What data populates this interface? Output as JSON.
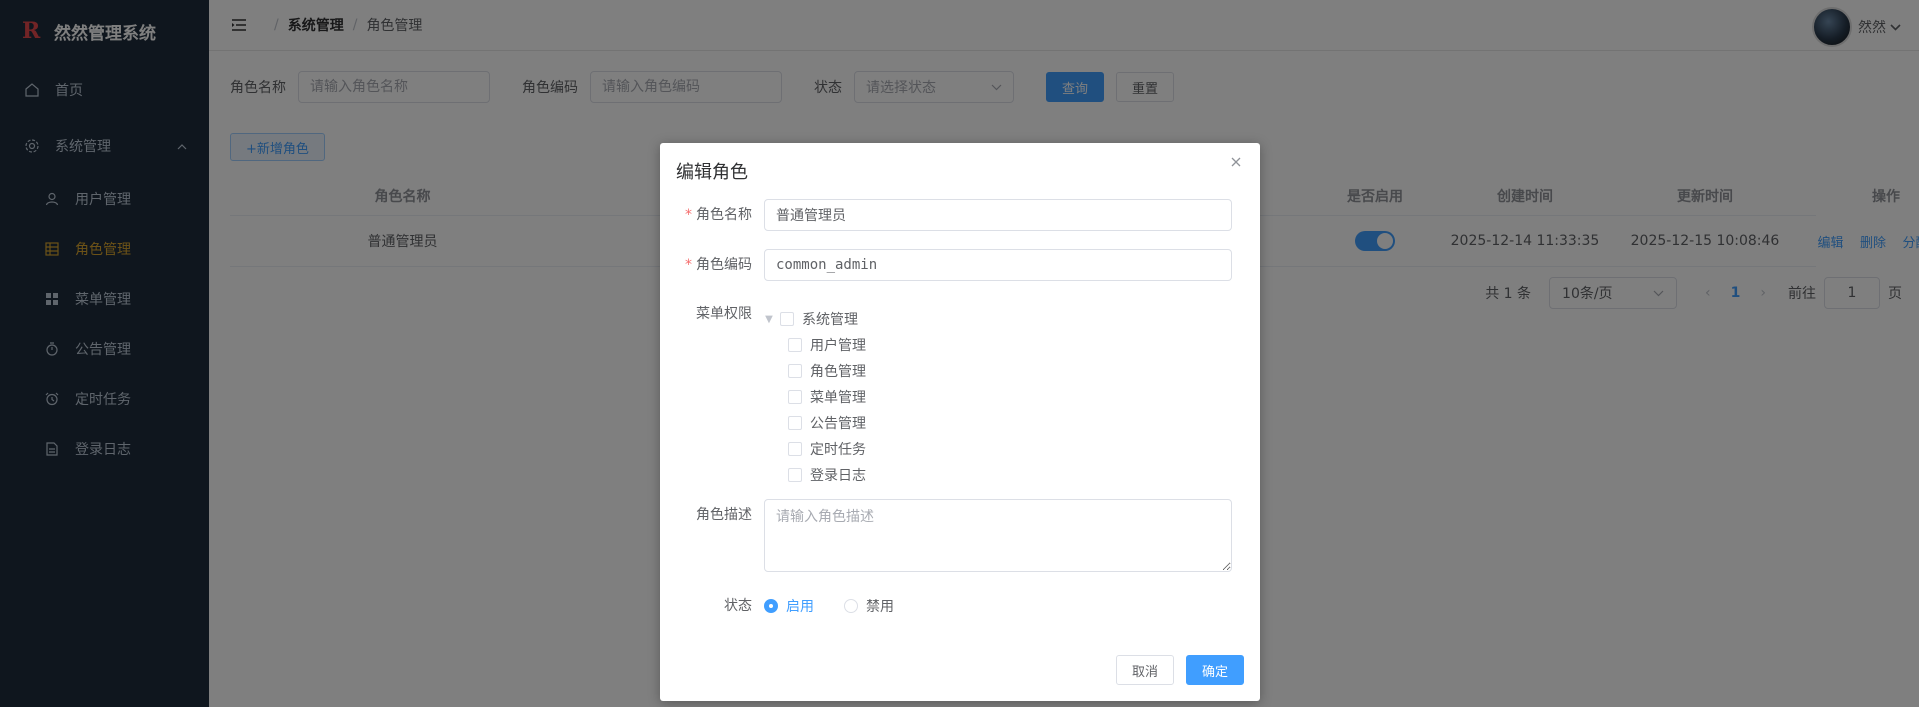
{
  "app": {
    "logo": "R",
    "title": "然然管理系统"
  },
  "sidebar": {
    "home": "首页",
    "system": "系统管理",
    "items": [
      {
        "label": "用户管理",
        "icon": "user-icon"
      },
      {
        "label": "角色管理",
        "icon": "grid-icon",
        "active": true
      },
      {
        "label": "菜单管理",
        "icon": "apps-icon"
      },
      {
        "label": "公告管理",
        "icon": "stopwatch-icon"
      },
      {
        "label": "定时任务",
        "icon": "alarm-clock-icon"
      },
      {
        "label": "登录日志",
        "icon": "document-icon"
      }
    ]
  },
  "header": {
    "breadcrumb": [
      "系统管理",
      "角色管理"
    ],
    "user_name": "然然"
  },
  "search": {
    "role_name_label": "角色名称",
    "role_name_placeholder": "请输入角色名称",
    "role_code_label": "角色编码",
    "role_code_placeholder": "请输入角色编码",
    "status_label": "状态",
    "status_placeholder": "请选择状态",
    "query_button": "查询",
    "reset_button": "重置"
  },
  "toolbar": {
    "add_button": "+新增角色"
  },
  "table": {
    "headers": [
      "角色名称",
      "是否启用",
      "创建时间",
      "更新时间",
      "操作"
    ],
    "rows": [
      {
        "name": "普通管理员",
        "enabled": true,
        "created": "2025-12-14 11:33:35",
        "updated": "2025-12-15 10:08:46"
      }
    ],
    "actions": [
      "编辑",
      "删除",
      "分配用户"
    ]
  },
  "pagination": {
    "total": "共 1 条",
    "page_size": "10条/页",
    "current_page": "1",
    "goto_label": "前往",
    "goto_value": "1",
    "page_suffix": "页"
  },
  "dialog": {
    "title": "编辑角色",
    "role_name_label": "角色名称",
    "role_name_value": "普通管理员",
    "role_code_label": "角色编码",
    "role_code_value": "common_admin",
    "menu_label": "菜单权限",
    "menu_tree": {
      "root": "系统管理",
      "children": [
        "用户管理",
        "角色管理",
        "菜单管理",
        "公告管理",
        "定时任务",
        "登录日志"
      ]
    },
    "desc_label": "角色描述",
    "desc_placeholder": "请输入角色描述",
    "status_label": "状态",
    "status_enabled": "启用",
    "status_disabled": "禁用",
    "cancel_button": "取消",
    "confirm_button": "确定"
  },
  "colors": {
    "primary": "#409eff",
    "sidebar_bg": "#1f2d3d",
    "active_menu": "#d8a52f",
    "required": "#f56c6c"
  }
}
